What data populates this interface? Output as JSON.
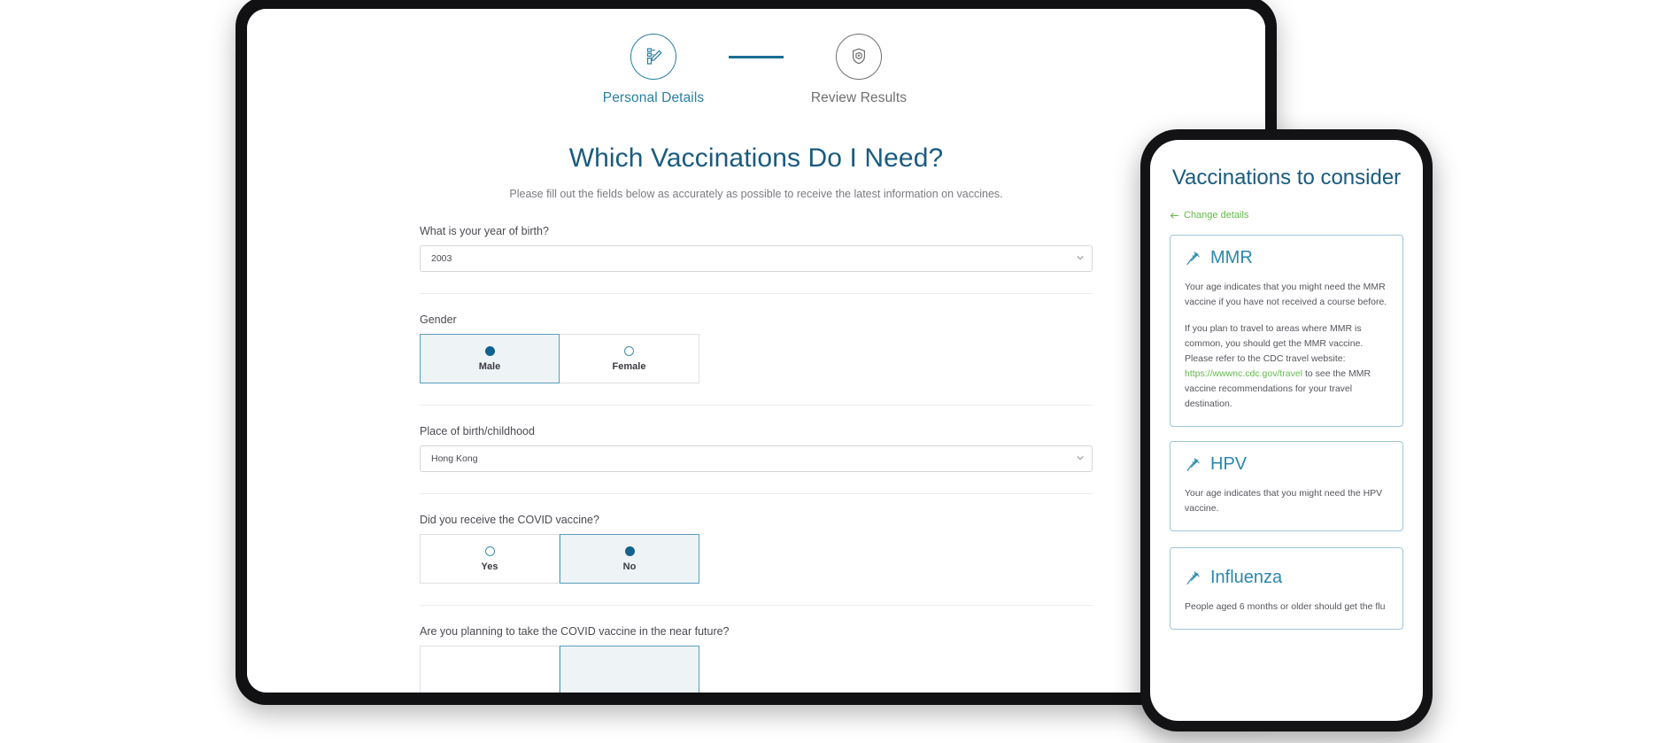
{
  "colors": {
    "brand_blue": "#1a5b80",
    "step_active": "#2a7ea3",
    "step_inactive": "#6f6f6f",
    "accent_green": "#63ba4b",
    "card_border": "#9ec7d8",
    "radio_selected_bg": "#eef3f6"
  },
  "tablet": {
    "stepper": {
      "steps": [
        {
          "label": "Personal Details",
          "icon": "checklist-edit-icon",
          "state": "active"
        },
        {
          "label": "Review Results",
          "icon": "shield-plus-icon",
          "state": "inactive"
        }
      ]
    },
    "form": {
      "title": "Which Vaccinations Do I Need?",
      "subtitle": "Please fill out the fields below as accurately as possible to receive the latest information on vaccines.",
      "fields": [
        {
          "type": "select",
          "label": "What is your year of birth?",
          "value": "2003",
          "placeholder": "Select year"
        },
        {
          "type": "radio",
          "label": "Gender",
          "options": [
            {
              "label": "Male",
              "selected": true
            },
            {
              "label": "Female",
              "selected": false
            }
          ]
        },
        {
          "type": "select",
          "label": "Place of birth/childhood",
          "value": "Hong Kong",
          "placeholder": "Select country"
        },
        {
          "type": "radio",
          "label": "Did you receive the COVID vaccine?",
          "options": [
            {
              "label": "Yes",
              "selected": false
            },
            {
              "label": "No",
              "selected": true
            }
          ]
        },
        {
          "type": "radio",
          "label": "Are you planning to take the COVID vaccine in the near future?",
          "options": []
        }
      ]
    }
  },
  "phone": {
    "title": "Vaccinations to consider",
    "change_link": "Change details",
    "change_icon": "arrow-left-icon",
    "cards": [
      {
        "name": "MMR",
        "icon": "syringe-icon",
        "paragraphs": [
          "Your age indicates that you might need the MMR vaccine if you have not received a course before.",
          "If you plan to travel to areas where MMR is common, you should get the MMR vaccine. Please refer to the CDC travel website: "
        ],
        "link_text": "https://wwwnc.cdc.gov/travel",
        "paragraph_tail": " to see the MMR vaccine recommendations for your travel destination."
      },
      {
        "name": "HPV",
        "icon": "syringe-icon",
        "paragraphs": [
          "Your age indicates that you might need the HPV vaccine."
        ]
      },
      {
        "name": "Influenza",
        "icon": "syringe-icon",
        "paragraphs": [
          "People aged 6 months or older should get the flu"
        ]
      }
    ]
  }
}
